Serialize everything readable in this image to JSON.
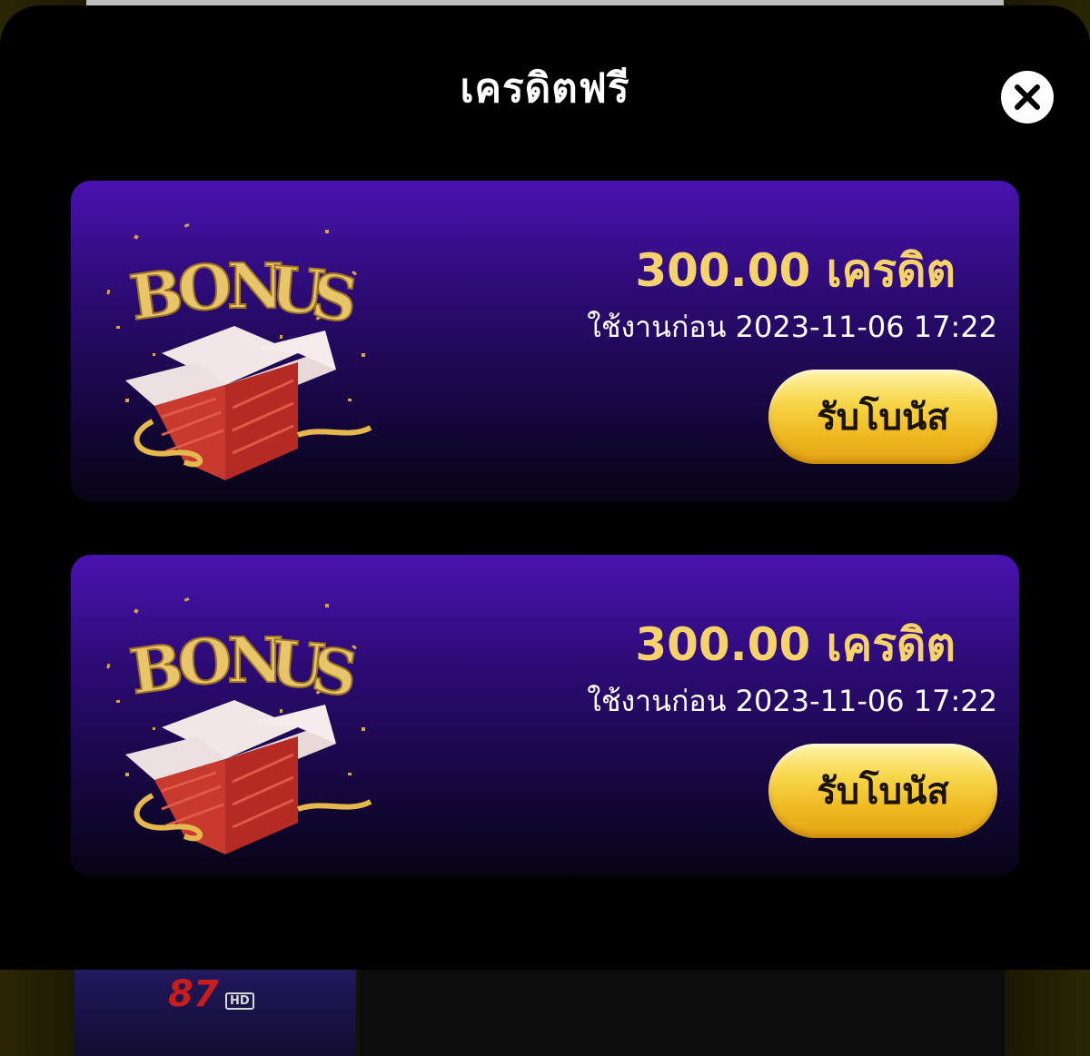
{
  "modal": {
    "title": "เครดิตฟรี",
    "close_icon": "close-icon"
  },
  "bonuses": [
    {
      "image_icon": "bonus-gift-box-icon",
      "amount": "300.00 เครดิต",
      "expiry": "ใช้งานก่อน 2023-11-06 17:22",
      "button_label": "รับโบนัส"
    },
    {
      "image_icon": "bonus-gift-box-icon",
      "amount": "300.00 เครดิต",
      "expiry": "ใช้งานก่อน 2023-11-06 17:22",
      "button_label": "รับโบนัส"
    }
  ],
  "colors": {
    "modal_background": "#000000",
    "card_gradient_top": "#4a12b0",
    "card_gradient_bottom": "#080414",
    "amount_text": "#f6d26a",
    "button_gold": "#f7d64a"
  }
}
